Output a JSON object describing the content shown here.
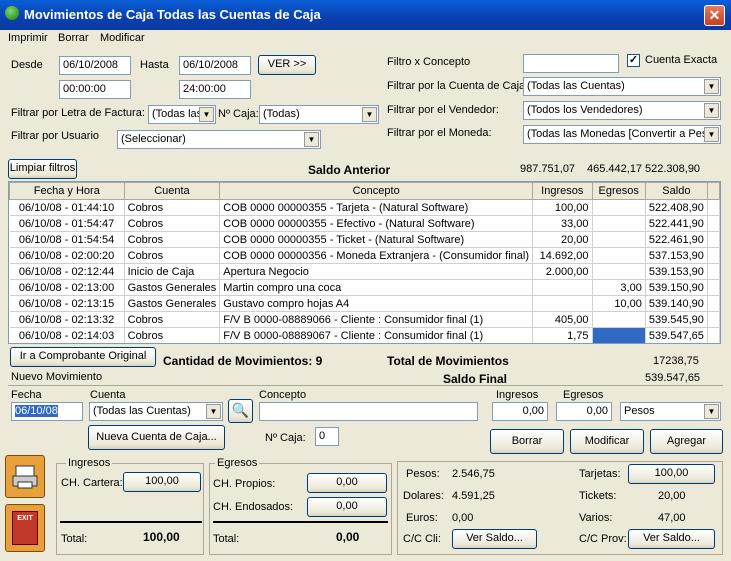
{
  "window": {
    "title": "Movimientos de Caja Todas las Cuentas de Caja",
    "close_label": "✕"
  },
  "menu": {
    "imprimir": "Imprimir",
    "borrar": "Borrar",
    "modificar": "Modificar"
  },
  "filters": {
    "desde_label": "Desde",
    "desde_date": "06/10/2008",
    "desde_time": "00:00:00",
    "hasta_label": "Hasta",
    "hasta_date": "06/10/2008",
    "hasta_time": "24:00:00",
    "ver_label": "VER >>",
    "letra_label": "Filtrar por Letra de Factura:",
    "letra_value": "(Todas las",
    "caja_label": "Nº Caja:",
    "caja_value": "(Todas)",
    "usuario_label": "Filtrar por Usuario",
    "usuario_value": "(Seleccionar)",
    "concepto_label": "Filtro x Concepto",
    "concepto_value": "",
    "cuenta_exacta_label": "Cuenta Exacta",
    "cuenta_exacta_checked": true,
    "cuenta_caja_label": "Filtrar por la Cuenta de Caja:",
    "cuenta_caja_value": "(Todas las Cuentas)",
    "vendedor_label": "Filtrar por el Vendedor:",
    "vendedor_value": "(Todos los Vendedores)",
    "moneda_label": "Filtrar por el Moneda:",
    "moneda_value": "(Todas las Monedas [Convertir a Peso"
  },
  "limpiar_label": "Limpiar filtros",
  "saldo_anterior": {
    "label": "Saldo Anterior",
    "v1": "987.751,07",
    "v2": "465.442,17",
    "v3": "522.308,90"
  },
  "grid": {
    "headers": [
      "Fecha y Hora",
      "Cuenta",
      "Concepto",
      "Ingresos",
      "Egresos",
      "Saldo"
    ],
    "rows": [
      [
        "06/10/08 - 01:44:10",
        "Cobros",
        "COB  0000 00000355 - Tarjeta - (Natural Software)",
        "100,00",
        "",
        "522.408,90"
      ],
      [
        "06/10/08 - 01:54:47",
        "Cobros",
        "COB  0000 00000355 - Efectivo - (Natural Software)",
        "33,00",
        "",
        "522.441,90"
      ],
      [
        "06/10/08 - 01:54:54",
        "Cobros",
        "COB  0000 00000355 - Ticket - (Natural Software)",
        "20,00",
        "",
        "522.461,90"
      ],
      [
        "06/10/08 - 02:00:20",
        "Cobros",
        "COB  0000 00000356 - Moneda Extranjera - (Consumidor final)",
        "14.692,00",
        "",
        "537.153,90"
      ],
      [
        "06/10/08 - 02:12:44",
        "Inicio de Caja",
        "Apertura Negocio",
        "2.000,00",
        "",
        "539.153,90"
      ],
      [
        "06/10/08 - 02:13:00",
        "Gastos Generales",
        "Martin compro una coca",
        "",
        "3,00",
        "539.150,90"
      ],
      [
        "06/10/08 - 02:13:15",
        "Gastos Generales",
        "Gustavo compro hojas A4",
        "",
        "10,00",
        "539.140,90"
      ],
      [
        "06/10/08 - 02:13:32",
        "Cobros",
        "F/V B 0000-08889066 - Cliente : Consumidor final (1)",
        "405,00",
        "",
        "539.545,90"
      ],
      [
        "06/10/08 - 02:14:03",
        "Cobros",
        "F/V B 0000-08889067 - Cliente : Consumidor final (1)",
        "1,75",
        "",
        "539.547,65"
      ]
    ]
  },
  "summary": {
    "ir_label": "Ir a Comprobante Original",
    "cantidad": "Cantidad de Movimientos: 9",
    "total_label": "Total de Movimientos",
    "total_value": "17238,75",
    "saldo_final_label": "Saldo Final",
    "saldo_final_value": "539.547,65",
    "nuevo_label": "Nuevo Movimiento"
  },
  "nuevo": {
    "fecha_label": "Fecha",
    "fecha_value": "06/10/08",
    "cuenta_label": "Cuenta",
    "cuenta_value": "(Todas las Cuentas)",
    "concepto_label": "Concepto",
    "concepto_value": "",
    "ingresos_label": "Ingresos",
    "ingresos_value": "0,00",
    "egresos_label": "Egresos",
    "egresos_value": "0,00",
    "moneda_value": "Pesos",
    "nueva_cuenta_label": "Nueva Cuenta de Caja...",
    "caja_label": "Nº Caja:",
    "caja_value": "0",
    "borrar_label": "Borrar",
    "modificar_label": "Modificar",
    "agregar_label": "Agregar"
  },
  "ingresos_panel": {
    "title": "Ingresos",
    "cartera_label": "CH. Cartera:",
    "cartera_value": "100,00",
    "total_label": "Total:",
    "total_value": "100,00"
  },
  "egresos_panel": {
    "title": "Egresos",
    "propios_label": "CH. Propios:",
    "propios_value": "0,00",
    "endosados_label": "CH. Endosados:",
    "endosados_value": "0,00",
    "total_label": "Total:",
    "total_value": "0,00"
  },
  "saldos": {
    "pesos_label": "Pesos:",
    "pesos_value": "2.546,75",
    "dolares_label": "Dolares:",
    "dolares_value": "4.591,25",
    "euros_label": "Euros:",
    "euros_value": "0,00",
    "cc_cli_label": "C/C Cli:",
    "ver_saldo_cli": "Ver Saldo...",
    "tarjetas_label": "Tarjetas:",
    "tarjetas_value": "100,00",
    "tickets_label": "Tickets:",
    "tickets_value": "20,00",
    "varios_label": "Varios:",
    "varios_value": "47,00",
    "cc_prov_label": "C/C Prov:",
    "ver_saldo_prov": "Ver Saldo..."
  },
  "side_icons": {
    "print": "printer-icon",
    "exit": "EXIT"
  }
}
